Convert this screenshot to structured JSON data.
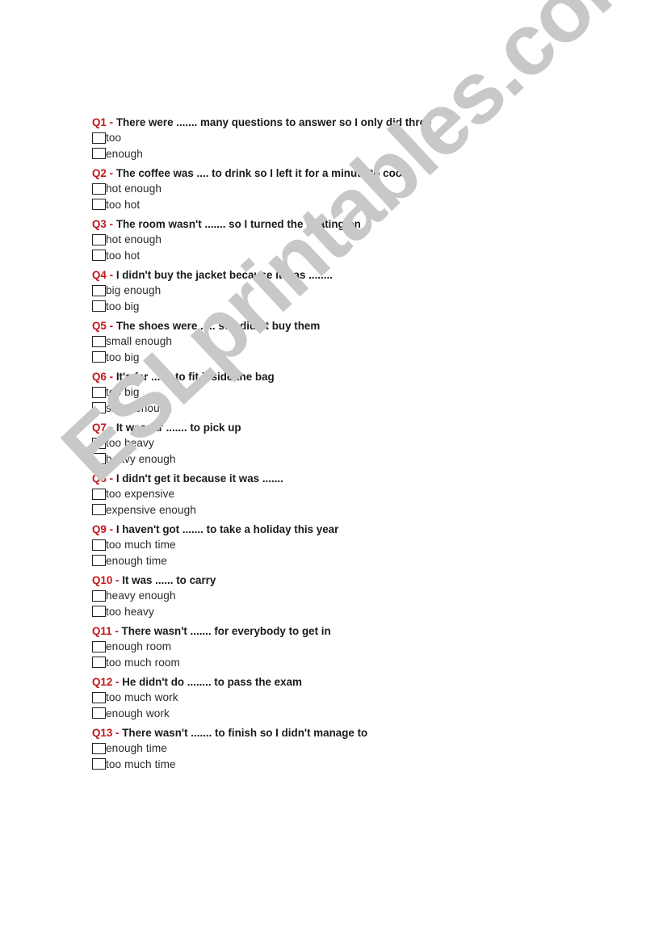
{
  "watermark": "ESLprintables.com",
  "colors": {
    "question_number": "#c0181c",
    "question_text": "#1a1a1a",
    "option_text": "#2a2a2a",
    "watermark": "#c8c8c8"
  },
  "questions": [
    {
      "number": "Q1",
      "separator": "-",
      "text": "There were ....... many questions to answer so I only did three",
      "options": [
        "too",
        "enough"
      ]
    },
    {
      "number": "Q2",
      "separator": "-",
      "text": "The coffee was .... to drink so I left it for a minute to cool",
      "options": [
        "hot enough",
        "too hot"
      ]
    },
    {
      "number": "Q3",
      "separator": "-",
      "text": "The room wasn't ....... so I turned the heating on",
      "options": [
        "hot enough",
        "too hot"
      ]
    },
    {
      "number": "Q4",
      "separator": "-",
      "text": "I didn't buy the jacket because it was ........",
      "options": [
        "big enough",
        "too big"
      ]
    },
    {
      "number": "Q5",
      "separator": "-",
      "text": "The shoes were ..... so I didn't buy them",
      "options": [
        "small enough",
        "too big"
      ]
    },
    {
      "number": "Q6",
      "separator": "-",
      "text": "It's far ....... to fit inside the bag",
      "options": [
        "too big",
        "small enough"
      ]
    },
    {
      "number": "Q7",
      "separator": "-",
      "text": "It was far ....... to pick up",
      "options": [
        "too heavy",
        "heavy enough"
      ]
    },
    {
      "number": "Q8",
      "separator": "-",
      "text": "I didn't get it because it was .......",
      "options": [
        "too expensive",
        "expensive enough"
      ]
    },
    {
      "number": "Q9",
      "separator": "-",
      "text": "I haven't got ....... to take a holiday this year",
      "options": [
        "too much time",
        "enough time"
      ]
    },
    {
      "number": "Q10",
      "separator": "-",
      "text": "It was ...... to carry",
      "options": [
        "heavy enough",
        "too heavy"
      ]
    },
    {
      "number": "Q11",
      "separator": "-",
      "text": "There wasn't ....... for everybody to get in",
      "options": [
        "enough room",
        "too much room"
      ]
    },
    {
      "number": "Q12",
      "separator": "-",
      "text": "He didn't do ........ to pass the exam",
      "options": [
        "too much work",
        "enough work"
      ]
    },
    {
      "number": "Q13",
      "separator": "-",
      "text": "There wasn't ....... to finish so I didn't manage to",
      "options": [
        "enough time",
        "too much time"
      ]
    }
  ]
}
